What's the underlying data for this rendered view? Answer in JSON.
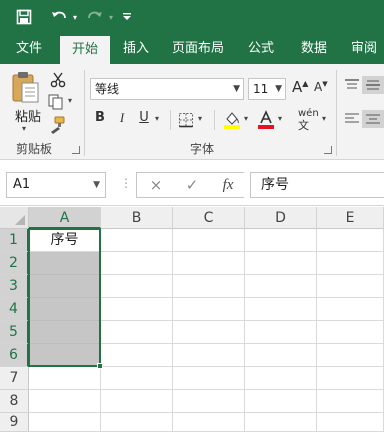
{
  "colors": {
    "brand": "#217346",
    "ribbon_bg": "#f3f3f3",
    "selection": "#217346",
    "shaded_cell": "#c6c6c6"
  },
  "quick_access": {
    "icons": [
      "save-icon",
      "undo-icon",
      "redo-icon",
      "customize-icon"
    ]
  },
  "tabs": [
    {
      "label": "文件",
      "active": false
    },
    {
      "label": "开始",
      "active": true
    },
    {
      "label": "插入",
      "active": false
    },
    {
      "label": "页面布局",
      "active": false
    },
    {
      "label": "公式",
      "active": false
    },
    {
      "label": "数据",
      "active": false
    },
    {
      "label": "审阅",
      "active": false
    }
  ],
  "ribbon": {
    "clipboard": {
      "paste_label": "粘贴",
      "group_label": "剪贴板"
    },
    "font": {
      "font_name": "等线",
      "font_size": "11",
      "group_label": "字体",
      "bold": "B",
      "italic": "I",
      "underline": "U",
      "grow_font": "A",
      "shrink_font": "A",
      "phonetic": "wén"
    }
  },
  "formula_bar": {
    "name_box": "A1",
    "cancel_icon": "×",
    "enter_icon": "✓",
    "fx_label": "fx",
    "content": "序号"
  },
  "grid": {
    "columns": [
      "A",
      "B",
      "C",
      "D",
      "E"
    ],
    "rows": [
      "1",
      "2",
      "3",
      "4",
      "5",
      "6",
      "7",
      "8",
      "9"
    ],
    "cells": {
      "A1": "序号"
    },
    "selected_range": "A1:A6"
  }
}
